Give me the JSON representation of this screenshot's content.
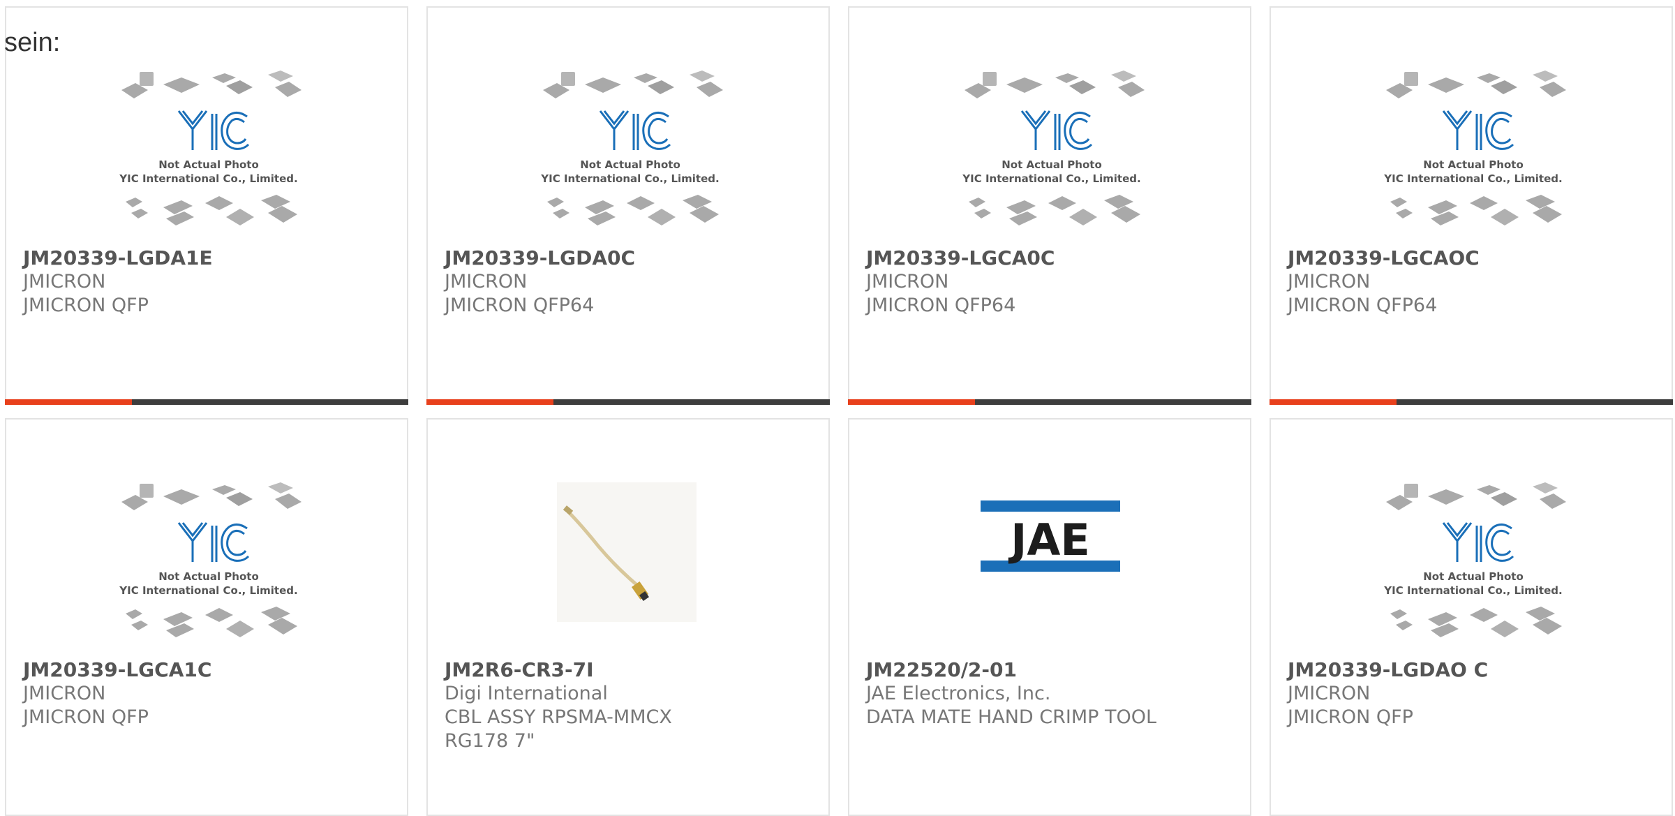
{
  "intro": "sein:",
  "placeholder": {
    "line1": "Not Actual Photo",
    "line2": "YIC International Co., Limited.",
    "logo": "YIC"
  },
  "colors": {
    "accent": "#e8401c",
    "bar": "#3d3d3d",
    "logo_blue": "#1a6fb8",
    "jae_blue": "#1b6fb8"
  },
  "products": [
    {
      "part": "JM20339-LGDA1E",
      "maker": "JMICRON",
      "desc": "JMICRON QFP",
      "image": "placeholder"
    },
    {
      "part": "JM20339-LGDA0C",
      "maker": "JMICRON",
      "desc": "JMICRON QFP64",
      "image": "placeholder"
    },
    {
      "part": "JM20339-LGCA0C",
      "maker": "JMICRON",
      "desc": "JMICRON QFP64",
      "image": "placeholder"
    },
    {
      "part": "JM20339-LGCAOC",
      "maker": "JMICRON",
      "desc": "JMICRON QFP64",
      "image": "placeholder"
    },
    {
      "part": "JM20339-LGCA1C",
      "maker": "JMICRON",
      "desc": "JMICRON QFP",
      "image": "placeholder"
    },
    {
      "part": "JM2R6-CR3-7I",
      "maker": "Digi International",
      "desc": "CBL ASSY RPSMA-MMCX RG178 7\"",
      "image": "cable-photo"
    },
    {
      "part": "JM22520/2-01",
      "maker": "JAE Electronics, Inc.",
      "desc": "DATA MATE HAND CRIMP TOOL",
      "image": "jae-logo",
      "logo_text": "JAE"
    },
    {
      "part": "JM20339-LGDAO C",
      "maker": "JMICRON",
      "desc": "JMICRON QFP",
      "image": "placeholder"
    }
  ]
}
